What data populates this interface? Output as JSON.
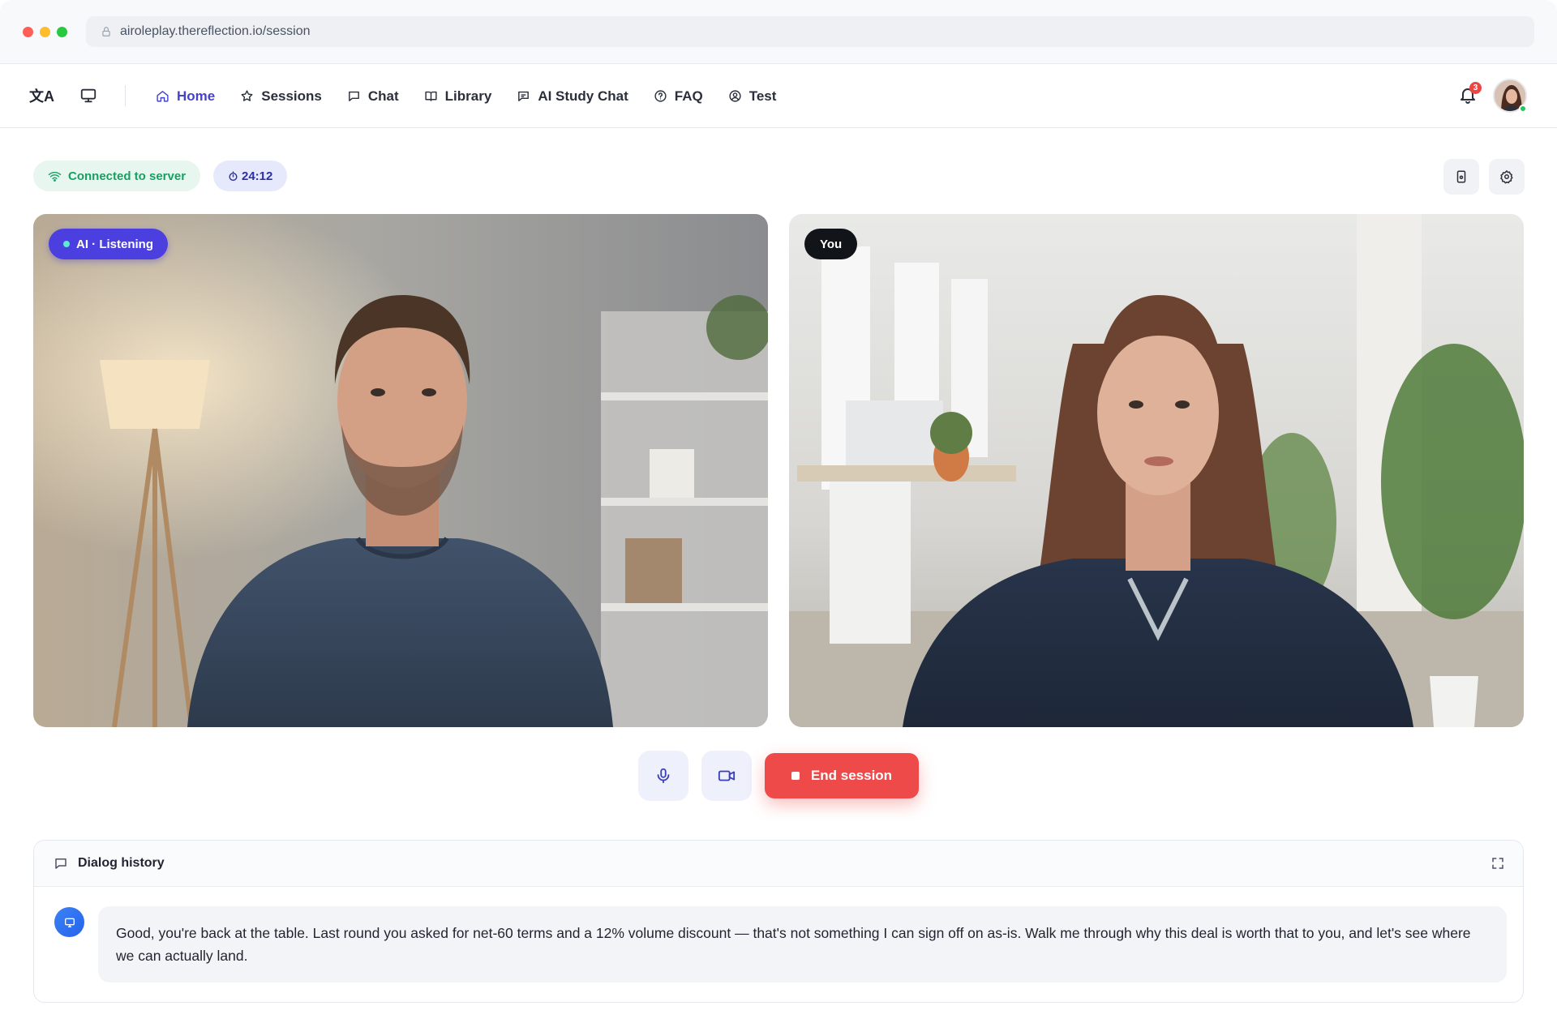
{
  "browser": {
    "url": "airoleplay.thereflection.io/session"
  },
  "nav": {
    "lang_label": "文A",
    "items": [
      {
        "label": "Home",
        "icon": "home-icon",
        "active": true
      },
      {
        "label": "Sessions",
        "icon": "star-icon"
      },
      {
        "label": "Chat",
        "icon": "chat-bubble-icon"
      },
      {
        "label": "Library",
        "icon": "book-icon"
      },
      {
        "label": "AI Study Chat",
        "icon": "message-square-icon"
      },
      {
        "label": "FAQ",
        "icon": "help-circle-icon"
      },
      {
        "label": "Test",
        "icon": "user-circle-icon"
      }
    ],
    "notification_count": "3"
  },
  "status": {
    "connection": "Connected to server",
    "timer": "24:12"
  },
  "tiles": {
    "ai_label": "AI · Listening",
    "you_label": "You"
  },
  "controls": {
    "end_session": "End session"
  },
  "dialog": {
    "title": "Dialog history",
    "messages": [
      {
        "role": "ai",
        "text": "Good, you're back at the table. Last round you asked for net-60 terms and a 12% volume discount — that's not something I can sign off on as-is. Walk me through why this deal is worth that to you, and let's see where we can actually land."
      }
    ]
  },
  "colors": {
    "accent": "#4443c9",
    "connected": "#16a163",
    "danger": "#ef4a4a",
    "ai_badge": "#4b3fe0"
  }
}
